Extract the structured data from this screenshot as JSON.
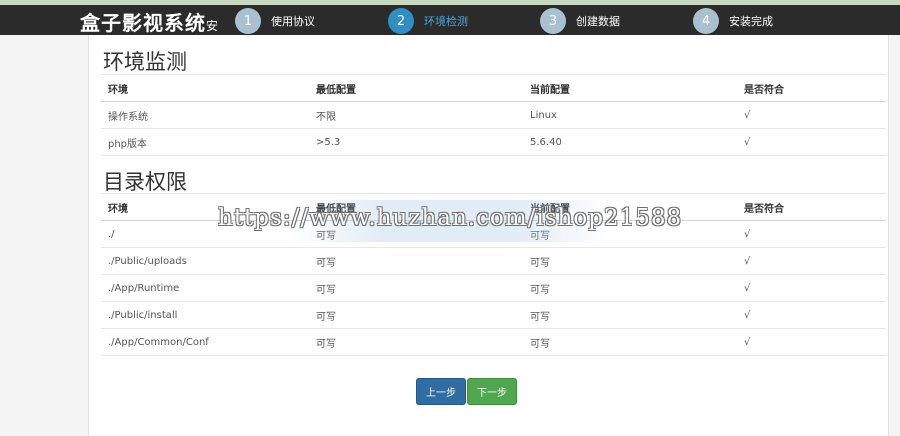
{
  "header": {
    "logo_main": "盒子影视系统",
    "logo_tail": "安",
    "steps": [
      {
        "num": "1",
        "label": "使用协议"
      },
      {
        "num": "2",
        "label": "环境检测"
      },
      {
        "num": "3",
        "label": "创建数据"
      },
      {
        "num": "4",
        "label": "安装完成"
      }
    ]
  },
  "env_section": {
    "title": "环境监测",
    "columns": [
      "环境",
      "最低配置",
      "当前配置",
      "是否符合"
    ],
    "rows": [
      [
        "操作系统",
        "不限",
        "Linux",
        "√"
      ],
      [
        "php版本",
        ">5.3",
        "5.6.40",
        "√"
      ]
    ]
  },
  "dir_section": {
    "title": "目录权限",
    "columns": [
      "环境",
      "最低配置",
      "当前配置",
      "是否符合"
    ],
    "rows": [
      [
        "./",
        "可写",
        "可写",
        "√"
      ],
      [
        "./Public/uploads",
        "可写",
        "可写",
        "√"
      ],
      [
        "./App/Runtime",
        "可写",
        "可写",
        "√"
      ],
      [
        "./Public/install",
        "可写",
        "可写",
        "√"
      ],
      [
        "./App/Common/Conf",
        "可写",
        "可写",
        "√"
      ]
    ]
  },
  "watermark": "https://www.huzhan.com/ishop21588",
  "buttons": {
    "prev": "上一步",
    "next": "下一步"
  }
}
